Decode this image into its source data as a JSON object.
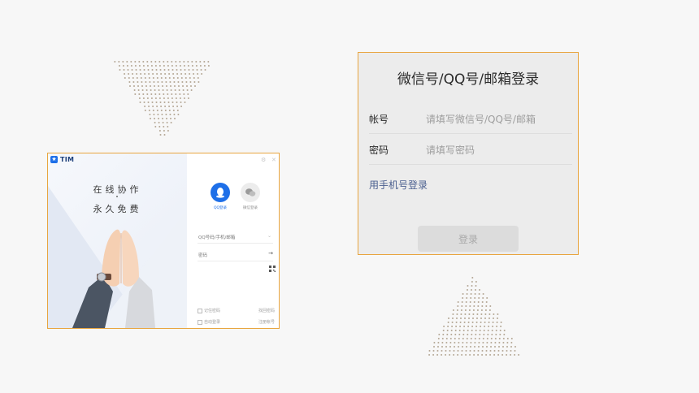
{
  "tim_window": {
    "logo_text": "TIM",
    "slogan_line1": "在线协作",
    "slogan_line2": "永久免费",
    "tabs": [
      {
        "label": "QQ登录",
        "icon": "qq-penguin-icon",
        "active": true
      },
      {
        "label": "微信登录",
        "icon": "wechat-icon",
        "active": false
      }
    ],
    "account_placeholder": "QQ号码/手机/邮箱",
    "password_placeholder": "密码",
    "remember_password": "记住密码",
    "auto_login": "自动登录",
    "retrieve_password": "找回密码",
    "register_account": "注册帐号"
  },
  "login_panel": {
    "title": "微信号/QQ号/邮箱登录",
    "account_label": "帐号",
    "account_placeholder": "请填写微信号/QQ号/邮箱",
    "password_label": "密码",
    "password_placeholder": "请填写密码",
    "phone_login_link": "用手机号登录",
    "submit_label": "登录"
  },
  "colors": {
    "accent_blue": "#1e6fe8",
    "frame_border": "#e8a53f",
    "link_color": "#4a5f8f",
    "dots": "#b4a694"
  }
}
